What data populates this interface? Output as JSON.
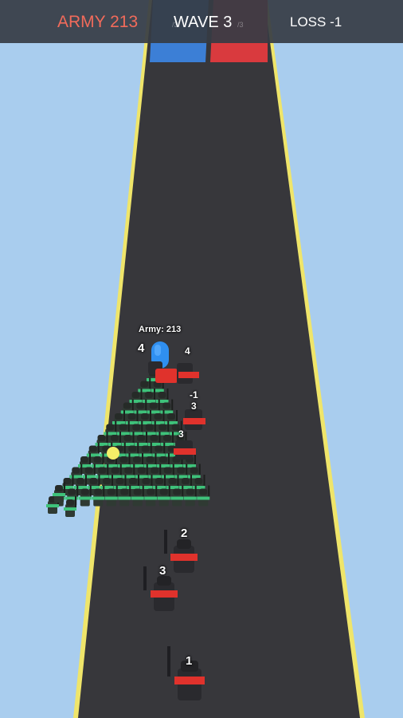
{
  "hud": {
    "army_label": "ARMY 213",
    "wave_label": "WAVE 3",
    "loss_label": "LOSS -1",
    "gate_counter_left": "/3",
    "gate_counter_right": "/3"
  },
  "player": {
    "army_tag": "Army: 213",
    "leader_number": "4"
  },
  "labels": {
    "enemy_near_leader": "4",
    "minus_marker": "-1",
    "enemy_mid_a": "3",
    "enemy_mid_b": "3",
    "enemy_road_1": "2",
    "enemy_road_2": "3",
    "enemy_road_3": "1"
  },
  "colors": {
    "sky": "#a9cdee",
    "road": "#36363a",
    "road_edge": "#f2e76a",
    "gate_blue": "#3b7fd4",
    "gate_red": "#d9353b",
    "soldier_green": "#3ec27a",
    "soldier_dark": "#2f3a33",
    "enemy_red": "#e0322c",
    "army_text": "#f26b5b"
  }
}
